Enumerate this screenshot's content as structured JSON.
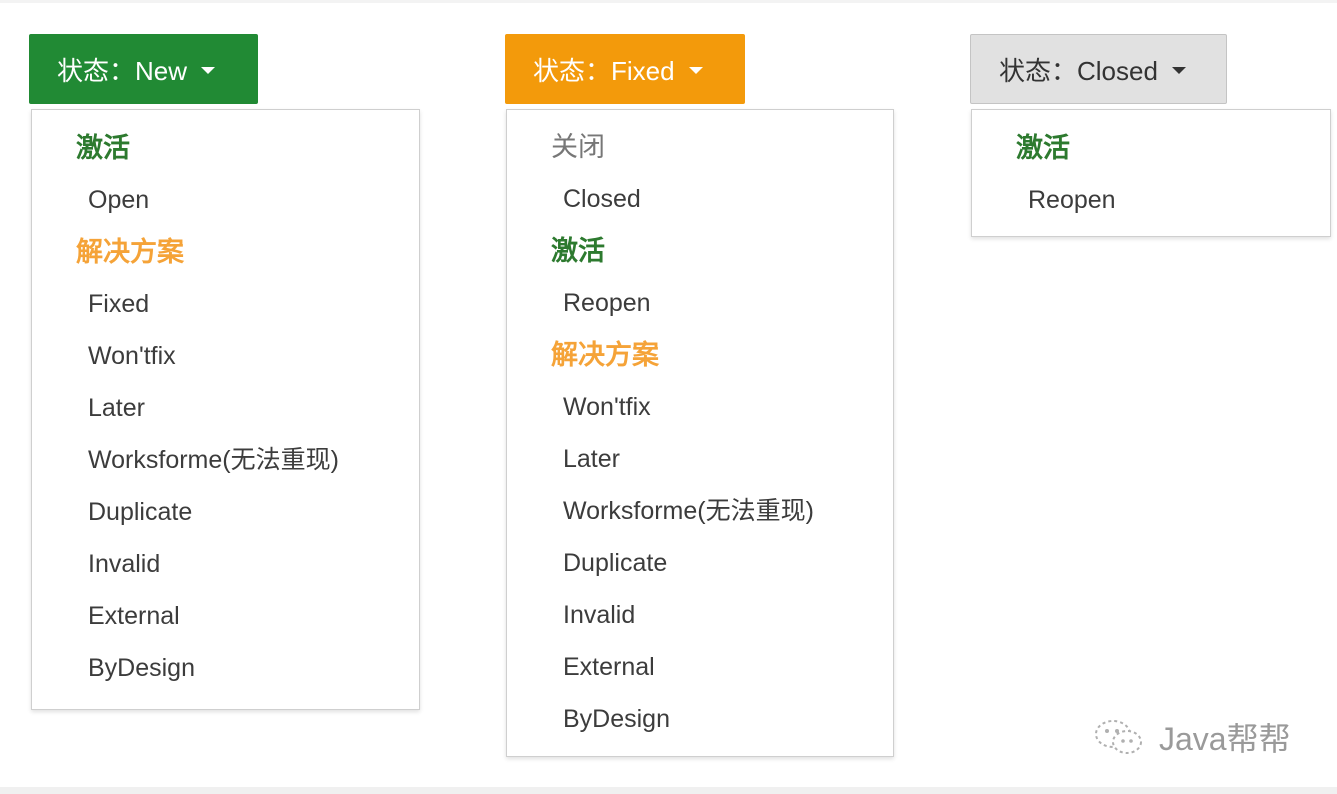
{
  "buttons": {
    "new": "状态：New",
    "fixed": "状态：Fixed",
    "closed": "状态：Closed"
  },
  "menus": {
    "new": [
      {
        "kind": "header",
        "style": "active",
        "label": "激活"
      },
      {
        "kind": "item",
        "label": "Open"
      },
      {
        "kind": "header",
        "style": "resolve",
        "label": "解决方案"
      },
      {
        "kind": "item",
        "label": "Fixed"
      },
      {
        "kind": "item",
        "label": "Won'tfix"
      },
      {
        "kind": "item",
        "label": "Later"
      },
      {
        "kind": "item",
        "label": "Worksforme(无法重现)"
      },
      {
        "kind": "item",
        "label": "Duplicate"
      },
      {
        "kind": "item",
        "label": "Invalid"
      },
      {
        "kind": "item",
        "label": "External"
      },
      {
        "kind": "item",
        "label": "ByDesign"
      }
    ],
    "fixed": [
      {
        "kind": "header",
        "style": "close",
        "label": "关闭"
      },
      {
        "kind": "item",
        "label": "Closed"
      },
      {
        "kind": "header",
        "style": "active",
        "label": "激活"
      },
      {
        "kind": "item",
        "label": "Reopen"
      },
      {
        "kind": "header",
        "style": "resolve",
        "label": "解决方案"
      },
      {
        "kind": "item",
        "label": "Won'tfix"
      },
      {
        "kind": "item",
        "label": "Later"
      },
      {
        "kind": "item",
        "label": "Worksforme(无法重现)"
      },
      {
        "kind": "item",
        "label": "Duplicate"
      },
      {
        "kind": "item",
        "label": "Invalid"
      },
      {
        "kind": "item",
        "label": "External"
      },
      {
        "kind": "item",
        "label": "ByDesign"
      }
    ],
    "closed": [
      {
        "kind": "header",
        "style": "active",
        "label": "激活"
      },
      {
        "kind": "item",
        "label": "Reopen"
      }
    ]
  },
  "colors": {
    "new_button": "#218a34",
    "fixed_button": "#f39a0b",
    "closed_button": "#e1e1e1",
    "header_active": "#2d7a2f",
    "header_resolve": "#f5a338",
    "header_close": "#777777"
  },
  "watermark": {
    "icon": "wechat-icon",
    "text": "Java帮帮"
  }
}
